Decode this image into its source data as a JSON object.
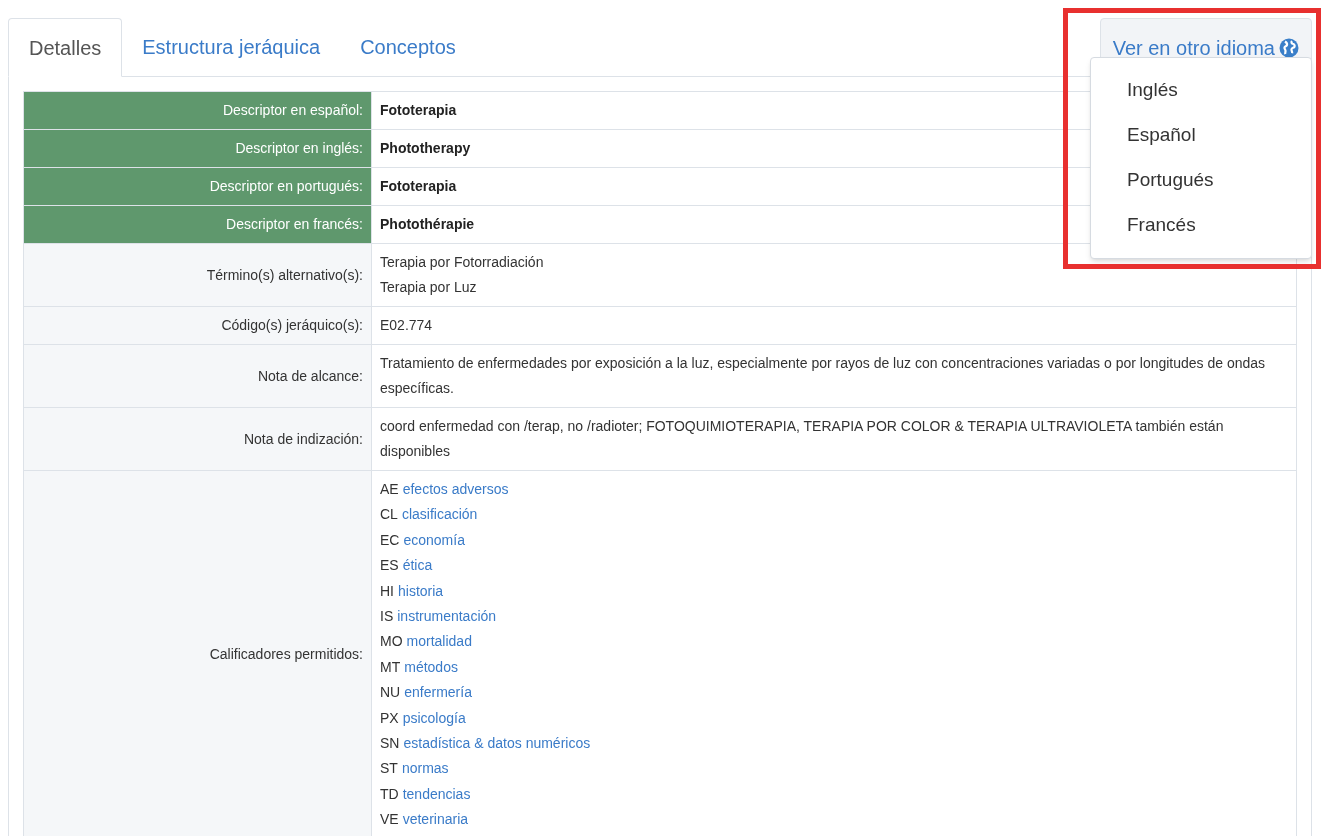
{
  "tabs": [
    {
      "label": "Detalles",
      "selected": true
    },
    {
      "label": "Estructura jeráquica",
      "selected": false
    },
    {
      "label": "Conceptos",
      "selected": false
    }
  ],
  "language_menu": {
    "label": "Ver en otro idioma",
    "expanded": true,
    "items": [
      "Inglés",
      "Español",
      "Portugués",
      "Francés"
    ]
  },
  "rows": [
    {
      "kind": "descriptor",
      "label": "Descriptor en español:",
      "value": "Fototerapia"
    },
    {
      "kind": "descriptor",
      "label": "Descriptor en inglés:",
      "value": "Phototherapy"
    },
    {
      "kind": "descriptor",
      "label": "Descriptor en portugués:",
      "value": "Fototerapia"
    },
    {
      "kind": "descriptor",
      "label": "Descriptor en francés:",
      "value": "Photothérapie"
    },
    {
      "kind": "lines",
      "label": "Término(s) alternativo(s):",
      "values": [
        "Terapia por Fotorradiación",
        "Terapia por Luz"
      ]
    },
    {
      "kind": "text",
      "label": "Código(s) jeráquico(s):",
      "value": "E02.774"
    },
    {
      "kind": "text",
      "label": "Nota de alcance:",
      "value": "Tratamiento de enfermedades por exposición a la luz, especialmente por rayos de luz con concentraciones variadas o por longitudes de ondas específicas."
    },
    {
      "kind": "text",
      "label": "Nota de indización:",
      "value": "coord enfermedad con /terap, no /radioter; FOTOQUIMIOTERAPIA, TERAPIA POR COLOR & TERAPIA ULTRAVIOLETA también están disponibles"
    },
    {
      "kind": "qualifiers",
      "label": "Calificadores permitidos:",
      "items": [
        {
          "code": "AE",
          "name": "efectos adversos"
        },
        {
          "code": "CL",
          "name": "clasificación"
        },
        {
          "code": "EC",
          "name": "economía"
        },
        {
          "code": "ES",
          "name": "ética"
        },
        {
          "code": "HI",
          "name": "historia"
        },
        {
          "code": "IS",
          "name": "instrumentación"
        },
        {
          "code": "MO",
          "name": "mortalidad"
        },
        {
          "code": "MT",
          "name": "métodos"
        },
        {
          "code": "NU",
          "name": "enfermería"
        },
        {
          "code": "PX",
          "name": "psicología"
        },
        {
          "code": "SN",
          "name": "estadística & datos numéricos"
        },
        {
          "code": "ST",
          "name": "normas"
        },
        {
          "code": "TD",
          "name": "tendencias"
        },
        {
          "code": "VE",
          "name": "veterinaria"
        }
      ]
    }
  ]
}
